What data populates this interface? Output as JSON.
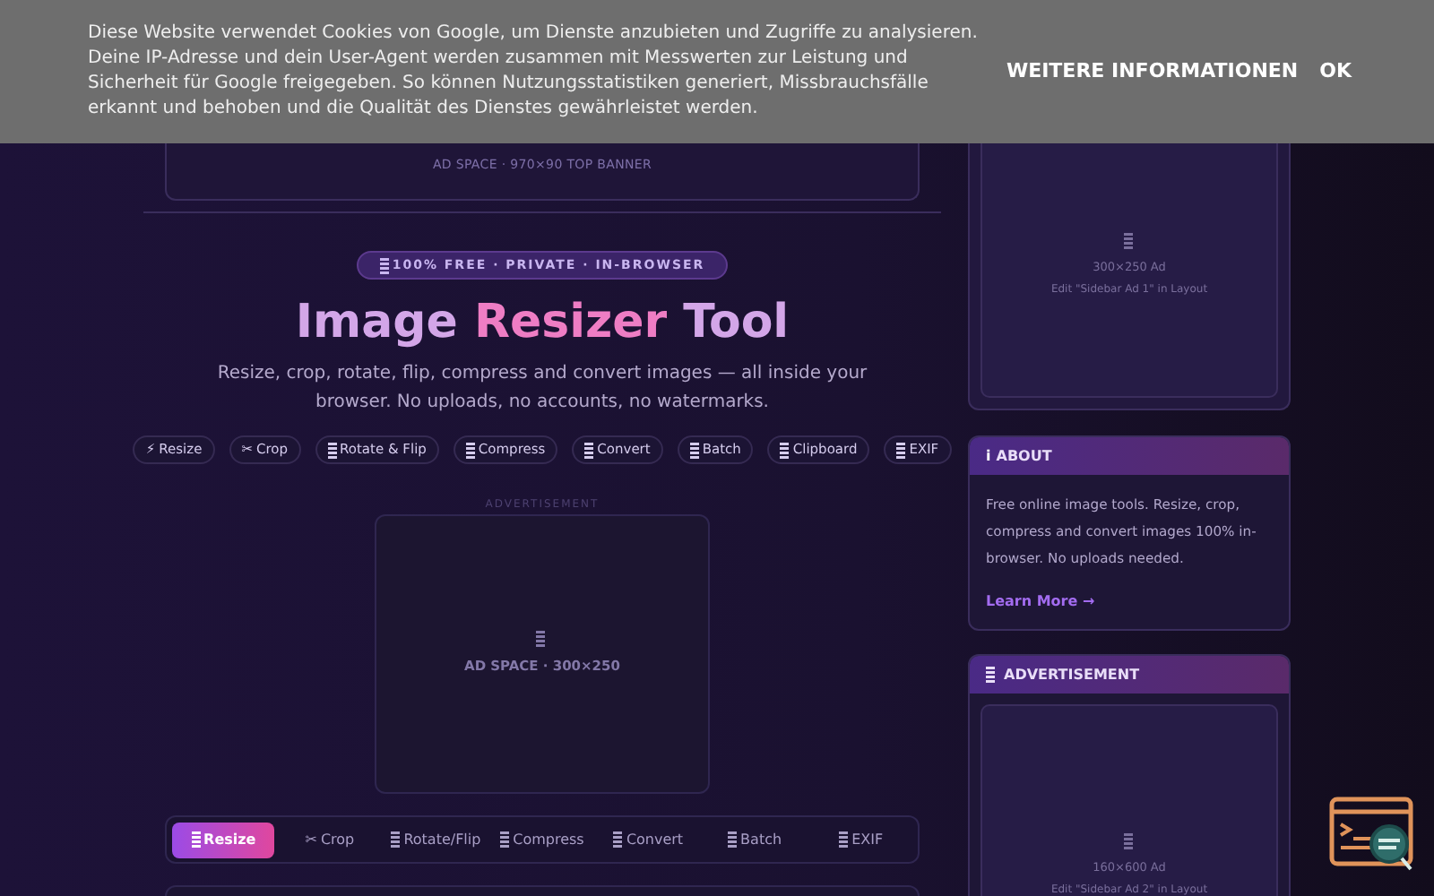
{
  "cookie_bar": {
    "text": "Diese Website verwendet Cookies von Google, um Dienste anzubieten und Zugriffe zu analysieren. Deine IP-Adresse und dein User-Agent werden zusammen mit Messwerten zur Leistung und Sicherheit für Google freigegeben. So können Nutzungsstatistiken generiert, Missbrauchsfälle erkannt und behoben und die Qualität des Dienstes gewährleistet werden.",
    "buttons": [
      "WEITERE INFORMATIONEN",
      "OK"
    ]
  },
  "top_banner": {
    "label": "AD SPACE · 970×90 TOP BANNER"
  },
  "hero": {
    "badge": "100% FREE · PRIVATE · IN-BROWSER",
    "title_parts": [
      "Image ",
      "Resizer",
      " Tool"
    ],
    "subtitle": "Resize, crop, rotate, flip, compress and convert images — all inside your browser. No uploads, no accounts, no watermarks.",
    "chips": [
      {
        "icon": "⚡",
        "label": "Resize"
      },
      {
        "icon": "✂",
        "label": "Crop"
      },
      {
        "label": "Rotate & Flip"
      },
      {
        "label": "Compress"
      },
      {
        "label": "Convert"
      },
      {
        "label": "Batch"
      },
      {
        "label": "Clipboard"
      },
      {
        "label": "EXIF"
      }
    ]
  },
  "ad": {
    "caption": "ADVERTISEMENT",
    "label": "AD SPACE · 300×250"
  },
  "tabs": [
    {
      "label": "Resize",
      "selected": true
    },
    {
      "icon": "✂",
      "label": "Crop",
      "selected": false
    },
    {
      "label": "Rotate/Flip",
      "selected": false
    },
    {
      "label": "Compress",
      "selected": false
    },
    {
      "label": "Convert",
      "selected": false
    },
    {
      "label": "Batch",
      "selected": false
    },
    {
      "label": "EXIF",
      "selected": false
    }
  ],
  "sidebar": {
    "ad1": {
      "size": "300×250 Ad",
      "hint": "Edit \"Sidebar Ad 1\" in Layout"
    },
    "about": {
      "title": "ABOUT",
      "icon": "i",
      "text": "Free online image tools. Resize, crop, compress and convert images 100% in-browser. No uploads needed.",
      "link": "Learn More →"
    },
    "ad2": {
      "title": "ADVERTISEMENT",
      "size": "160×600 Ad",
      "hint": "Edit \"Sidebar Ad 2\" in Layout"
    }
  }
}
